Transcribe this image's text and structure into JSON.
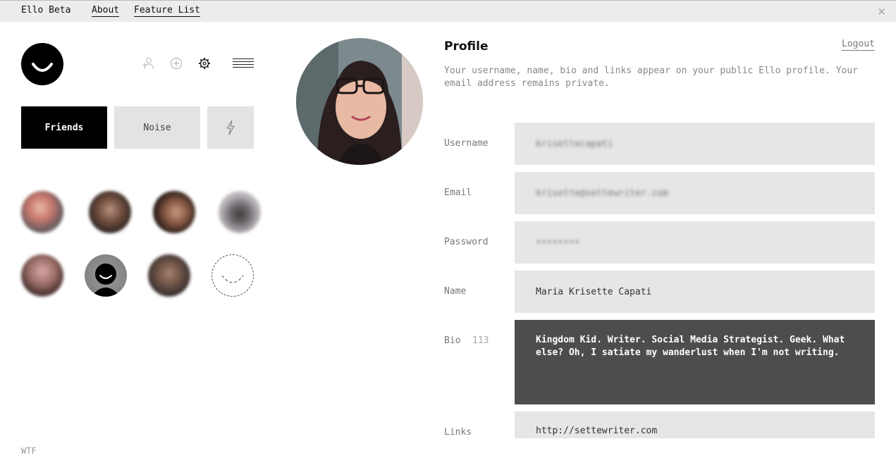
{
  "nav": {
    "brand": "Ello Beta",
    "about": "About",
    "feature_list": "Feature List",
    "close_glyph": "×"
  },
  "sidebar": {
    "tabs": {
      "friends": "Friends",
      "noise": "Noise"
    },
    "icons": [
      "add-friend-icon",
      "add-icon",
      "settings-icon",
      "menu-icon",
      "lightning-icon"
    ],
    "footer": "WTF"
  },
  "profile": {
    "title": "Profile",
    "logout": "Logout",
    "description": "Your username, name, bio and links appear on your public Ello profile. Your email address remains private.",
    "fields": {
      "username": {
        "label": "Username",
        "value": "krisettecapati"
      },
      "email": {
        "label": "Email",
        "value": "krisette@settewriter.com"
      },
      "password": {
        "label": "Password",
        "value": "••••••••"
      },
      "name": {
        "label": "Name",
        "value": "Maria Krisette Capati"
      },
      "bio": {
        "label": "Bio",
        "counter": "113",
        "value": "Kingdom Kid. Writer. Social Media Strategist. Geek. What else? Oh, I satiate my wanderlust when I'm not writing."
      },
      "links": {
        "label": "Links",
        "value": "http://settewriter.com"
      }
    }
  },
  "colors": {
    "active_tab": "#000000",
    "inactive_tab": "#e3e3e3",
    "field_bg": "#e6e6e6",
    "bio_bg": "#4d4d4d",
    "topbar_bg": "#ececec"
  }
}
